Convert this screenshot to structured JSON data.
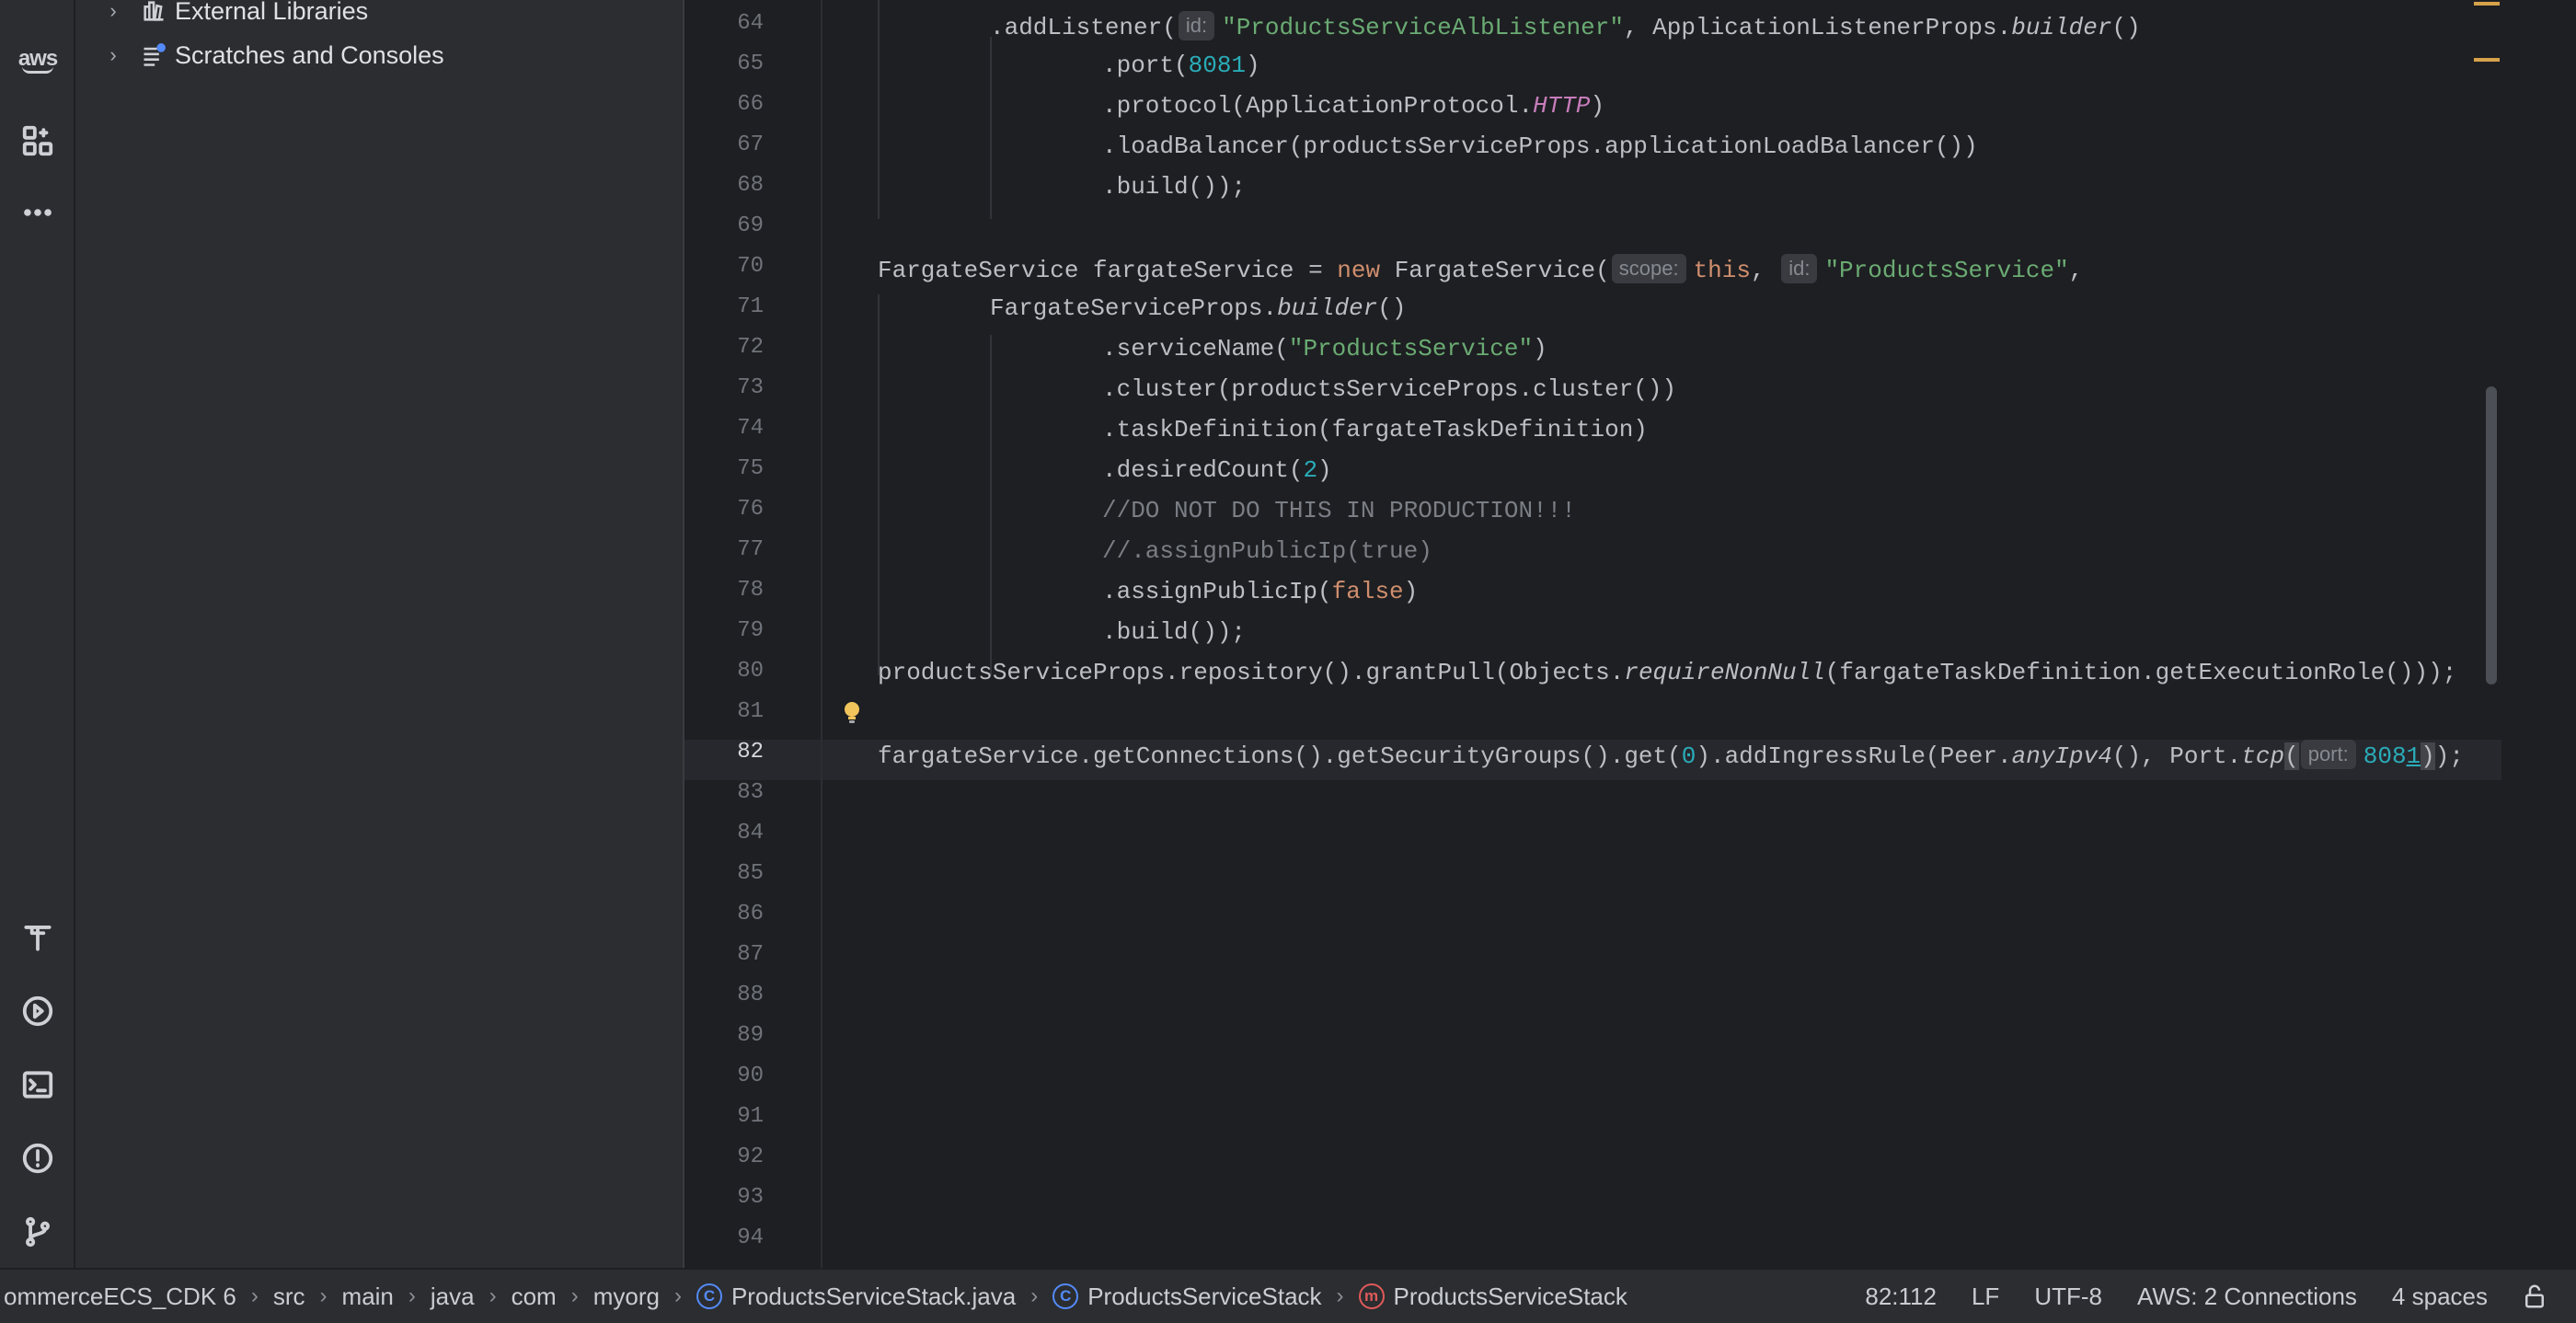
{
  "colors": {
    "background": "#1e1f22",
    "panel": "#2b2d30",
    "keyword": "#cf8e6d",
    "string": "#6aab73",
    "number": "#2aacb8",
    "constant": "#c77dbb",
    "comment": "#7a7e85",
    "accent_blue": "#548af7",
    "marker": "#d6a24a"
  },
  "activity_bar": {
    "top_items": [
      "aws-icon",
      "structure-icon",
      "more-icon"
    ],
    "aws_label": "aws",
    "bottom_items": [
      "build-icon",
      "run-icon",
      "terminal-icon",
      "problems-icon",
      "git-icon"
    ]
  },
  "project_tree": {
    "items": [
      {
        "label": "External Libraries",
        "icon": "library-icon"
      },
      {
        "label": "Scratches and Consoles",
        "icon": "scratches-icon"
      }
    ]
  },
  "editor": {
    "current_line": 82,
    "line_numbers": [
      "64",
      "65",
      "66",
      "67",
      "68",
      "69",
      "70",
      "71",
      "72",
      "73",
      "74",
      "75",
      "76",
      "77",
      "78",
      "79",
      "80",
      "81",
      "82",
      "83",
      "84",
      "85",
      "86",
      "87",
      "88",
      "89",
      "90",
      "91",
      "92",
      "93",
      "94"
    ],
    "code": {
      "l64": {
        "t1": ".addListener(",
        "hint": "id:",
        "s1": "\"ProductsServiceAlbListener\"",
        "t2": ", ApplicationListenerProps.",
        "it": "builder",
        "t3": "()"
      },
      "l65": {
        "t1": ".port(",
        "n1": "8081",
        "t2": ")"
      },
      "l66": {
        "t1": ".protocol(ApplicationProtocol.",
        "c1": "HTTP",
        "t2": ")"
      },
      "l67": {
        "t1": ".loadBalancer(productsServiceProps.applicationLoadBalancer())"
      },
      "l68": {
        "t1": ".build());"
      },
      "l70": {
        "t1": "FargateService fargateService = ",
        "k1": "new",
        "t2": " FargateService(",
        "h1": "scope:",
        "k2": "this",
        "t3": ", ",
        "h2": "id:",
        "s1": "\"ProductsService\"",
        "t4": ","
      },
      "l71": {
        "t1": "FargateServiceProps.",
        "it": "builder",
        "t2": "()"
      },
      "l72": {
        "t1": ".serviceName(",
        "s1": "\"ProductsService\"",
        "t2": ")"
      },
      "l73": {
        "t1": ".cluster(productsServiceProps.cluster())"
      },
      "l74": {
        "t1": ".taskDefinition(fargateTaskDefinition)"
      },
      "l75": {
        "t1": ".desiredCount(",
        "n1": "2",
        "t2": ")"
      },
      "l76": {
        "cmt": "//DO NOT DO THIS IN PRODUCTION!!!"
      },
      "l77": {
        "cmt": "//.assignPublicIp(true)"
      },
      "l78": {
        "t1": ".assignPublicIp(",
        "k1": "false",
        "t2": ")"
      },
      "l79": {
        "t1": ".build());"
      },
      "l80": {
        "t1": "productsServiceProps.repository().grantPull(Objects.",
        "it": "requireNonNull",
        "t2": "(fargateTaskDefinition.getExecutionRole()));"
      },
      "l82": {
        "t1": "fargateService.getConnections().getSecurityGroups().get(",
        "n1": "0",
        "t2": ").addIngressRule(Peer.",
        "it1": "anyIpv4",
        "t3": "(), Port.",
        "it2": "tcp",
        "p1": "(",
        "hint": "port:",
        "n2": "808",
        "n3": "1",
        "p2": ")",
        "t4": ");"
      }
    }
  },
  "status_bar": {
    "breadcrumbs": {
      "project": "ommerceECS_CDK 6",
      "src": "src",
      "main": "main",
      "java": "java",
      "com": "com",
      "myorg": "myorg",
      "file": "ProductsServiceStack.java",
      "class": "ProductsServiceStack",
      "method": "ProductsServiceStack"
    },
    "position": "82:112",
    "line_sep": "LF",
    "encoding": "UTF-8",
    "aws": "AWS: 2 Connections",
    "indent": "4 spaces"
  }
}
